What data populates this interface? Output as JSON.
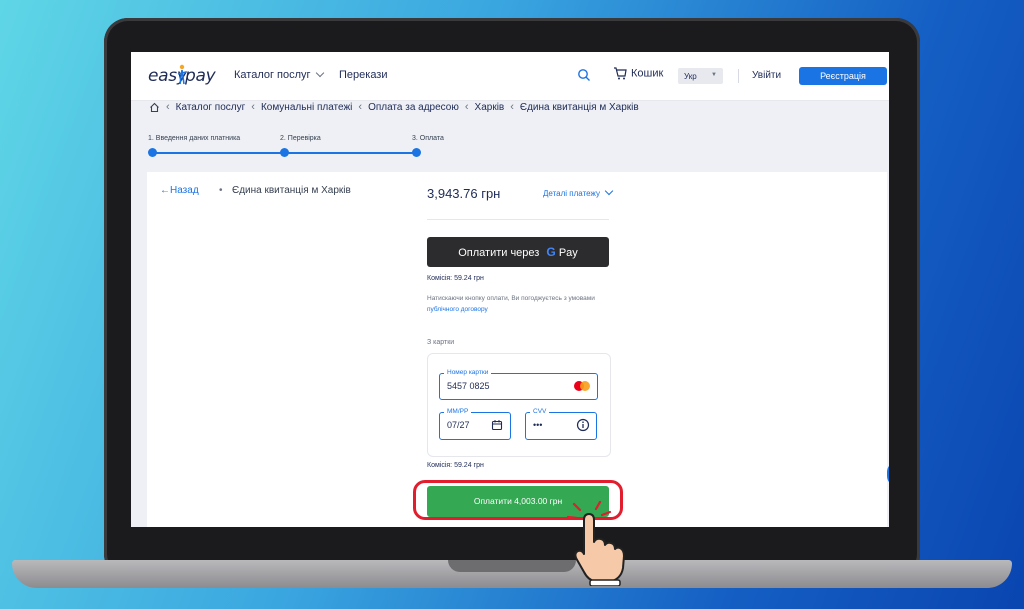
{
  "header": {
    "logo_left": "easy",
    "logo_right": "pay",
    "nav": {
      "catalog": "Каталог послуг",
      "transfers": "Перекази"
    },
    "cart_label": "Кошик",
    "language": "Укр",
    "login": "Увійти",
    "register": "Реєстрація"
  },
  "breadcrumb": [
    "Каталог послуг",
    "Комунальні платежі",
    "Оплата за адресою",
    "Харків",
    "Єдина квитанція м Харків"
  ],
  "steps": [
    {
      "label": "1. Введення даних платника"
    },
    {
      "label": "2. Перевірка"
    },
    {
      "label": "3. Оплата"
    }
  ],
  "payment": {
    "back": "Назад",
    "bullet": "•",
    "service": "Єдина квитанція м Харків",
    "amount": "3,943.76 грн",
    "details": "Деталі платежу",
    "gpay_label": "Оплатити через",
    "gpay_g": "G",
    "gpay_pay": "Pay",
    "commission_gpay": "Комісія: 59.24 грн",
    "agree_text": "Натискаючи кнопку оплати, Ви погоджуєтесь з умовами",
    "agree_link": "публічного договору",
    "from_card": "З картки",
    "card_number_label": "Номер картки",
    "card_number": "5457 0825",
    "expiry_label": "ММ/РР",
    "expiry": "07/27",
    "cvv_label": "CVV",
    "cvv": "•••",
    "commission_card": "Комісія: 59.24 грн",
    "pay_button": "Оплатити 4,003.00 грн"
  },
  "colors": {
    "accent": "#1b74e4",
    "pay_green": "#34a853",
    "highlight_red": "#e11d2e"
  }
}
